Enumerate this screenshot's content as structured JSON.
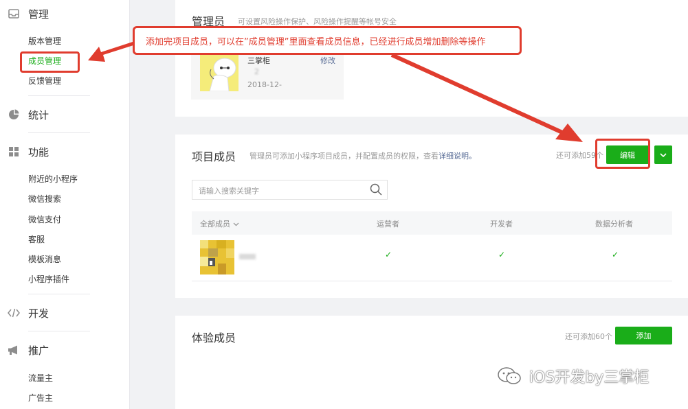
{
  "sidebar": {
    "groups": [
      {
        "label": "管理",
        "icon": "inbox-icon",
        "items": [
          "版本管理",
          "成员管理",
          "反馈管理"
        ]
      },
      {
        "label": "统计",
        "icon": "pie-chart-icon",
        "items": []
      },
      {
        "label": "功能",
        "icon": "grid-icon",
        "items": [
          "附近的小程序",
          "微信搜索",
          "微信支付",
          "客服",
          "模板消息",
          "小程序插件"
        ]
      },
      {
        "label": "开发",
        "icon": "code-icon",
        "items": []
      },
      {
        "label": "推广",
        "icon": "megaphone-icon",
        "items": [
          "流量主",
          "广告主"
        ]
      }
    ],
    "active_item": "成员管理"
  },
  "admin_section": {
    "title": "管理员",
    "hint": "可设置风险操作保护、风险操作提醒等帐号安全",
    "admin": {
      "name": "三掌柜",
      "id": "2",
      "date": "2018-12-",
      "edit_label": "修改"
    }
  },
  "members_section": {
    "title": "项目成员",
    "hint": "管理员可添加小程序项目成员，并配置成员的权限，查看",
    "hint_link": "详细说明。",
    "quota": "还可添加59个",
    "edit_label": "编辑",
    "search_placeholder": "请输入搜索关键字",
    "columns": [
      "全部成员",
      "运营者",
      "开发者",
      "数据分析者"
    ],
    "rows": [
      {
        "name": "",
        "operator": "✓",
        "developer": "✓",
        "analyst": "✓"
      }
    ]
  },
  "trial_section": {
    "title": "体验成员",
    "quota": "还可添加60个",
    "add_label": "添加"
  },
  "annotation": {
    "text": "添加完项目成员，可以在”成员管理”里面查看成员信息，已经进行成员增加删除等操作"
  },
  "watermark": {
    "text": "iOS开发by三掌柜"
  },
  "colors": {
    "accent": "#1aad19",
    "annotation": "#e03c2e",
    "link": "#576b95"
  }
}
